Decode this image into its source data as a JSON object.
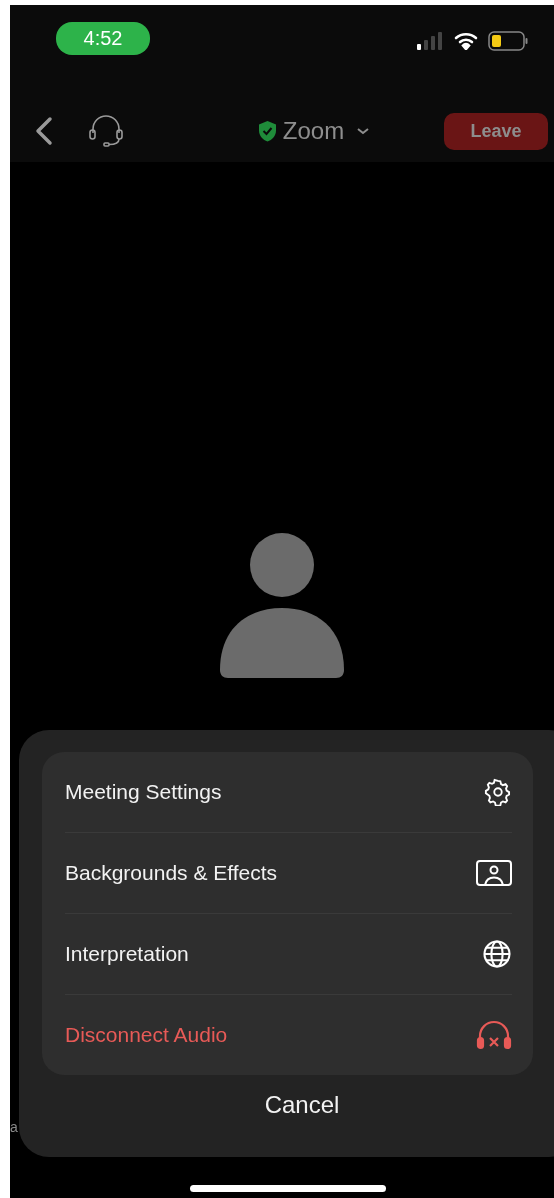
{
  "status_bar": {
    "time": "4:52"
  },
  "top_bar": {
    "title": "Zoom",
    "leave_button": "Leave"
  },
  "side_text": "a",
  "action_sheet": {
    "items": [
      {
        "label": "Meeting Settings",
        "kind": "normal"
      },
      {
        "label": "Backgrounds & Effects",
        "kind": "normal"
      },
      {
        "label": "Interpretation",
        "kind": "normal"
      },
      {
        "label": "Disconnect Audio",
        "kind": "danger"
      }
    ],
    "cancel": "Cancel"
  }
}
